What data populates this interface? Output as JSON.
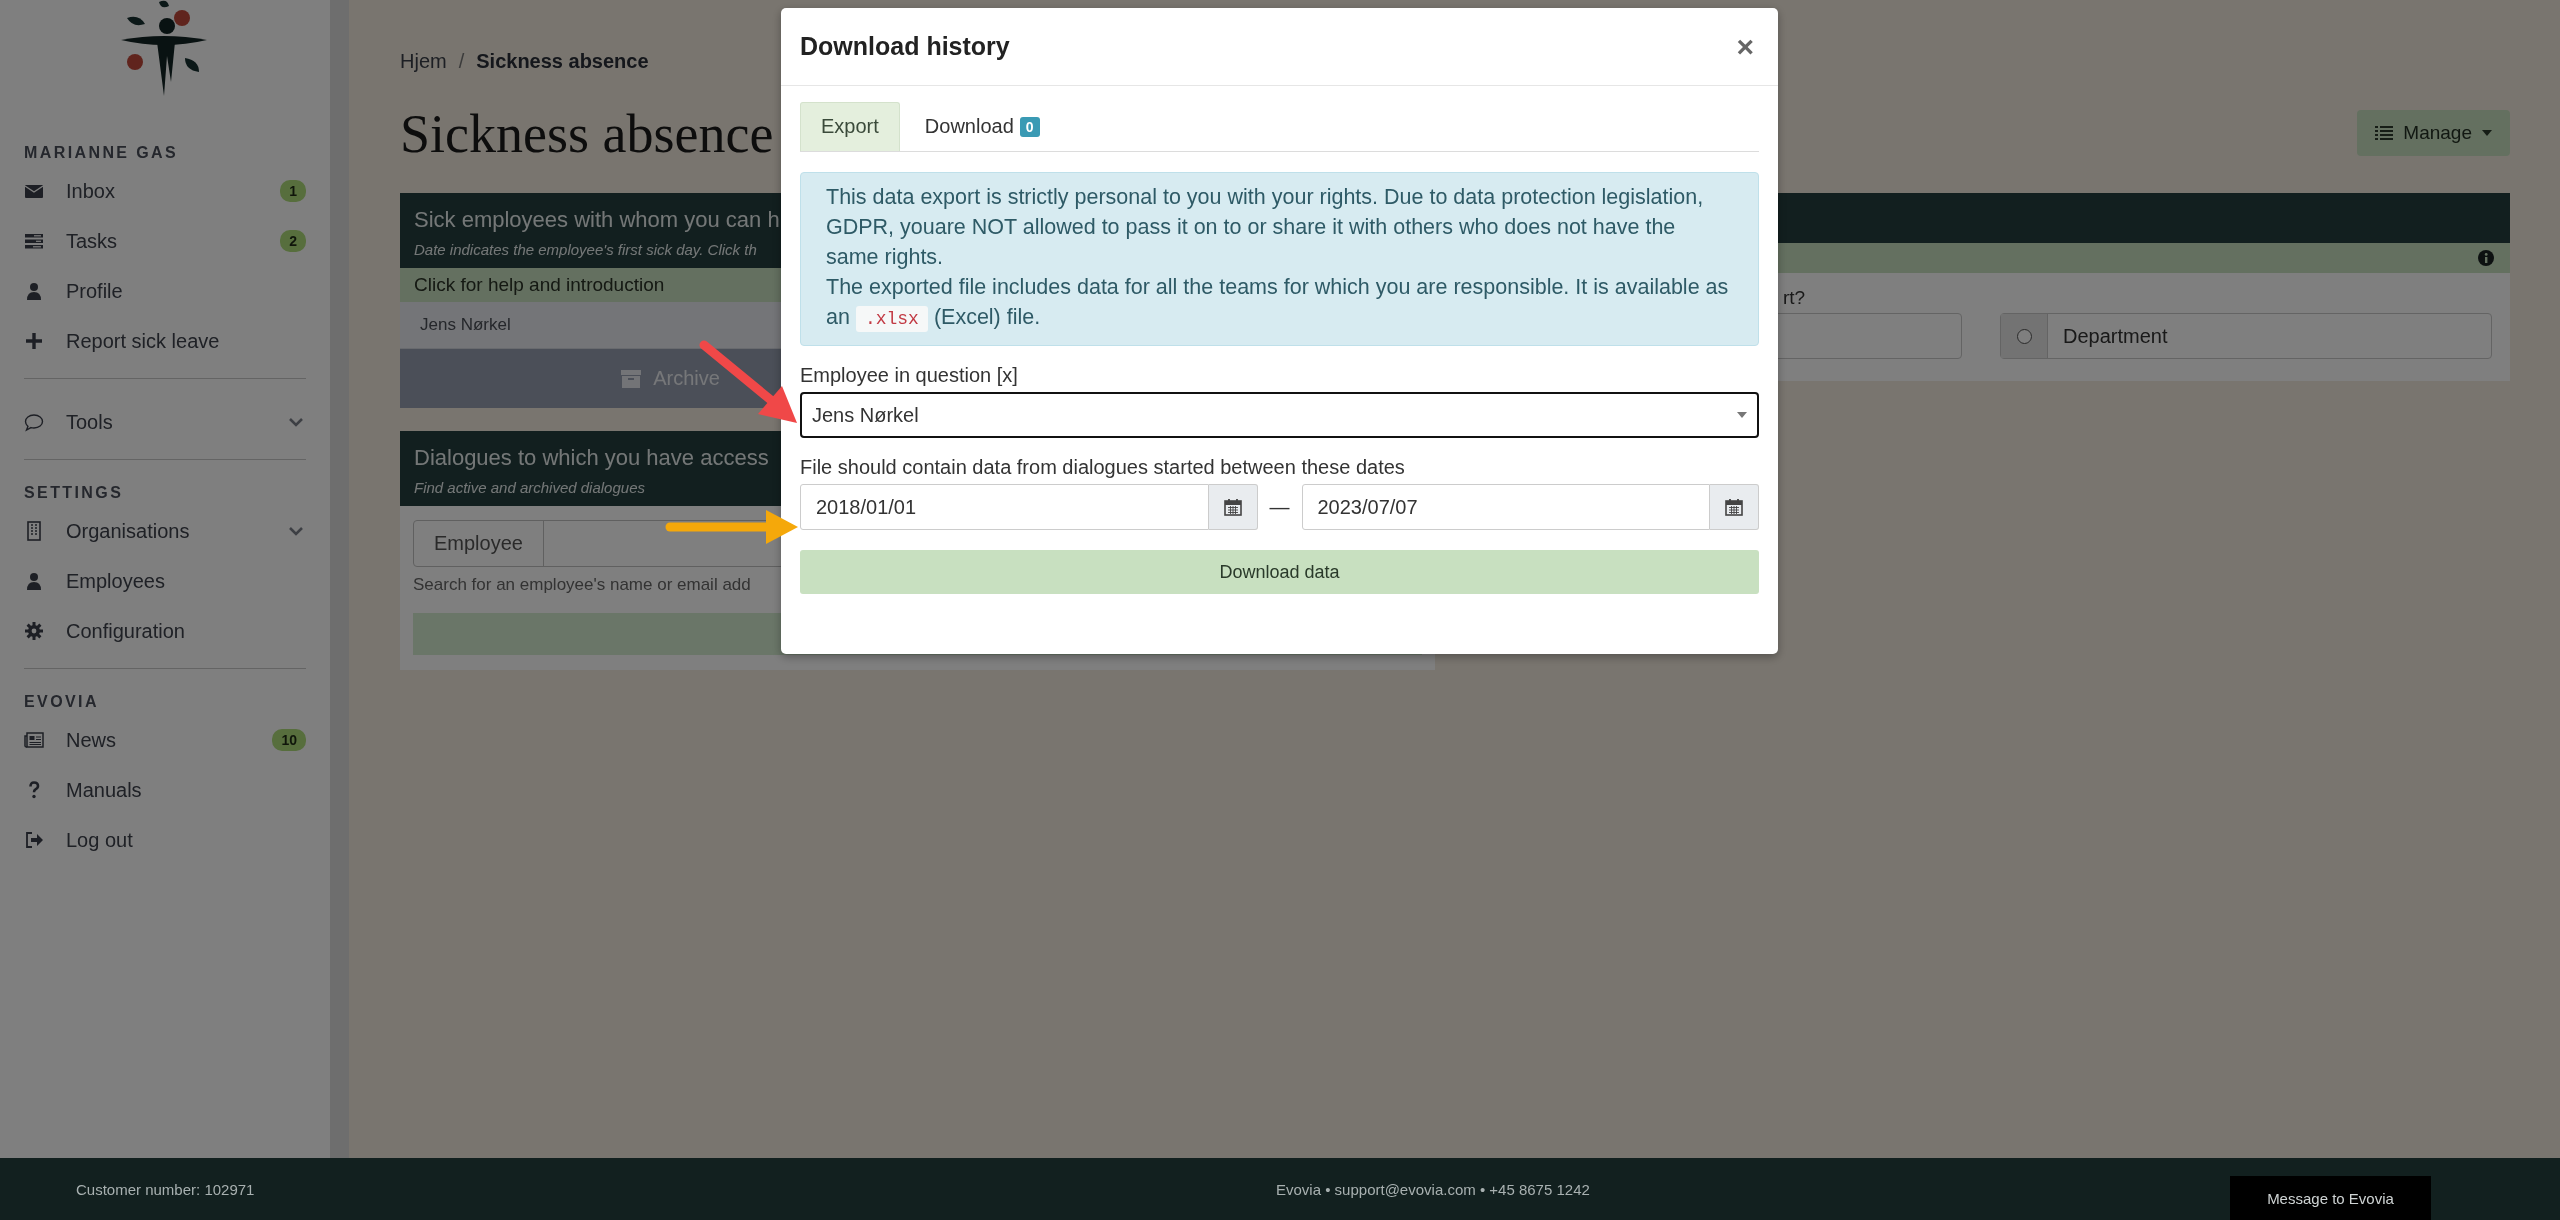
{
  "sidebar": {
    "sections": [
      {
        "heading": "MARIANNE GAS",
        "items": [
          {
            "label": "Inbox",
            "kind": "link",
            "badge": "1"
          },
          {
            "label": "Tasks",
            "kind": "link",
            "badge": "2"
          },
          {
            "label": "Profile",
            "kind": "link"
          },
          {
            "label": "Report sick leave",
            "kind": "link"
          }
        ]
      },
      {
        "items": [
          {
            "label": "Tools",
            "kind": "group"
          }
        ]
      },
      {
        "heading": "SETTINGS",
        "items": [
          {
            "label": "Organisations",
            "kind": "group"
          },
          {
            "label": "Employees",
            "kind": "link"
          },
          {
            "label": "Configuration",
            "kind": "link"
          }
        ]
      },
      {
        "heading": "EVOVIA",
        "items": [
          {
            "label": "News",
            "kind": "link",
            "badge": "10"
          },
          {
            "label": "Manuals",
            "kind": "link"
          },
          {
            "label": "Log out",
            "kind": "link"
          }
        ]
      }
    ]
  },
  "breadcrumb": {
    "separator": "/",
    "items": [
      "Hjem",
      "Sickness absence"
    ]
  },
  "page_title": "Sickness absence",
  "manage_button": "Manage",
  "sick_card": {
    "title": "Sick employees with whom you can h",
    "subtitle": "Date indicates the employee's first sick day. Click th",
    "help": "Click for help and introduction",
    "employees": [
      "Jens Nørkel"
    ],
    "archive_button": "Archive"
  },
  "dialogues_card": {
    "title": "Dialogues to which you have access",
    "subtitle": "Find active and archived dialogues",
    "search_label": "Employee",
    "hint": "Search for an employee's name or email add"
  },
  "report_card": {
    "question": "rt?",
    "options": [
      {
        "label": "Department",
        "selected": false
      }
    ]
  },
  "modal": {
    "title": "Download history",
    "close": "×",
    "tabs": [
      {
        "label": "Export",
        "selected": true
      },
      {
        "label": "Download",
        "selected": false,
        "badge": "0"
      }
    ],
    "notice": {
      "text": "This data export is strictly personal to you with your rights. Due to data protection legislation, GDPR, youare NOT allowed to pass it on to or share it with others who does not have the same rights.",
      "before_code": "The exported file includes data for all the teams for which you are responsible. It is available as an",
      "code": ".xlsx",
      "after_code": "(Excel) file."
    },
    "employee_field": {
      "label": "Employee in question [x]",
      "value": "Jens Nørkel"
    },
    "date_range": {
      "label": "File should contain data from dialogues started between these dates",
      "from": "2018/01/01",
      "separator": "—",
      "to": "2023/07/07"
    },
    "download_button": "Download data"
  },
  "footer": {
    "customer": "Customer number: 102971",
    "contact": "Evovia • support@evovia.com • +45 8675 1242",
    "message_button": "Message to Evovia"
  }
}
